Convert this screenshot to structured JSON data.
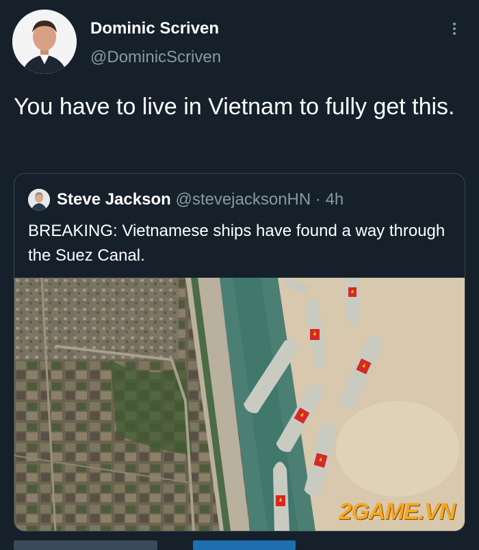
{
  "author": {
    "name": "Dominic Scriven",
    "handle": "@DominicScriven"
  },
  "tweet": {
    "text": "You have to live in Vietnam to fully get this."
  },
  "quoted_tweet": {
    "name": "Steve Jackson",
    "handle": "@stevejacksonHN",
    "separator": "·",
    "time": "4h",
    "text": "BREAKING: Vietnamese ships have found a way through the Suez Canal."
  },
  "watermark": "2GAME.VN",
  "icons": {
    "more": "more-vertical-icon"
  },
  "colors": {
    "background": "#15202b",
    "secondary_text": "#8899a6",
    "border": "#38444d",
    "watermark": "#f5a623"
  }
}
